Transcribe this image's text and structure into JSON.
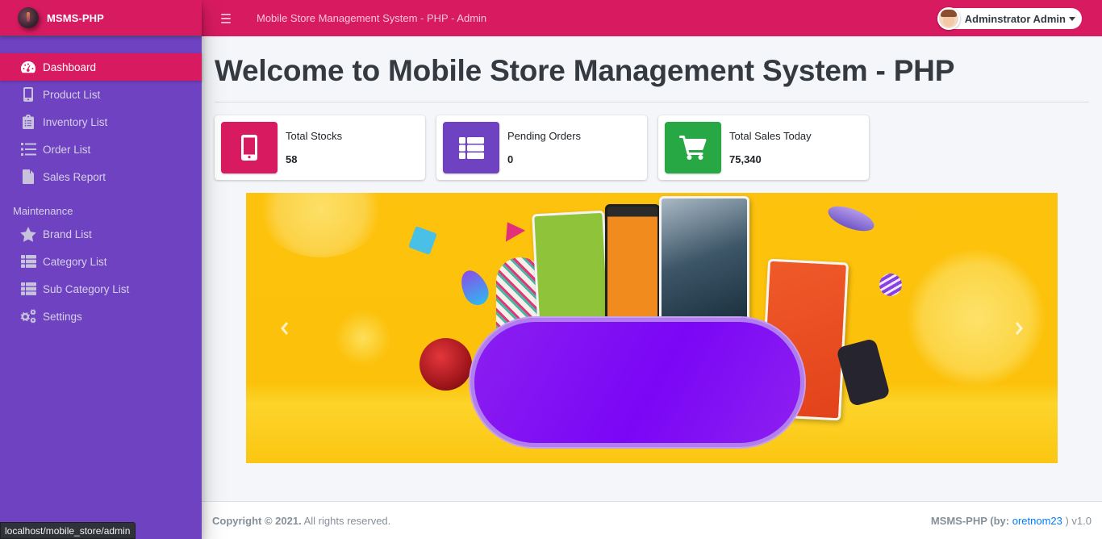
{
  "brand": {
    "name": "MSMS-PHP"
  },
  "topbar": {
    "title": "Mobile Store Management System - PHP - Admin",
    "user_name": "Adminstrator Admin"
  },
  "sidebar": {
    "items": [
      {
        "label": "Dashboard",
        "icon": "tachometer-icon",
        "active": true
      },
      {
        "label": "Product List",
        "icon": "mobile-icon"
      },
      {
        "label": "Inventory List",
        "icon": "clipboard-list-icon"
      },
      {
        "label": "Order List",
        "icon": "list-icon"
      },
      {
        "label": "Sales Report",
        "icon": "file-icon"
      }
    ],
    "maintenance_header": "Maintenance",
    "maintenance_items": [
      {
        "label": "Brand List",
        "icon": "star-icon"
      },
      {
        "label": "Category List",
        "icon": "th-list-icon"
      },
      {
        "label": "Sub Category List",
        "icon": "th-list-icon"
      },
      {
        "label": "Settings",
        "icon": "cogs-icon"
      }
    ]
  },
  "main": {
    "title": "Welcome to Mobile Store Management System - PHP",
    "info_boxes": [
      {
        "label": "Total Stocks",
        "value": "58",
        "icon": "mobile-icon",
        "color": "#d81b60"
      },
      {
        "label": "Pending Orders",
        "value": "0",
        "icon": "th-list-icon",
        "color": "#6f42c1"
      },
      {
        "label": "Total Sales Today",
        "value": "75,340",
        "icon": "shopping-cart-icon",
        "color": "#28a745"
      }
    ],
    "carousel": {
      "prev_label": "Previous",
      "next_label": "Next"
    }
  },
  "footer": {
    "copyright_bold": "Copyright © 2021.",
    "copyright_rest": " All rights reserved.",
    "credit_prefix": "MSMS-PHP (by: ",
    "credit_link": "oretnom23",
    "credit_suffix": " ) v1.0"
  },
  "status_bar": {
    "url": "localhost/mobile_store/admin"
  },
  "colors": {
    "primary": "#d81b60",
    "sidebar": "#6f42c1",
    "success": "#28a745",
    "link": "#007bff"
  }
}
